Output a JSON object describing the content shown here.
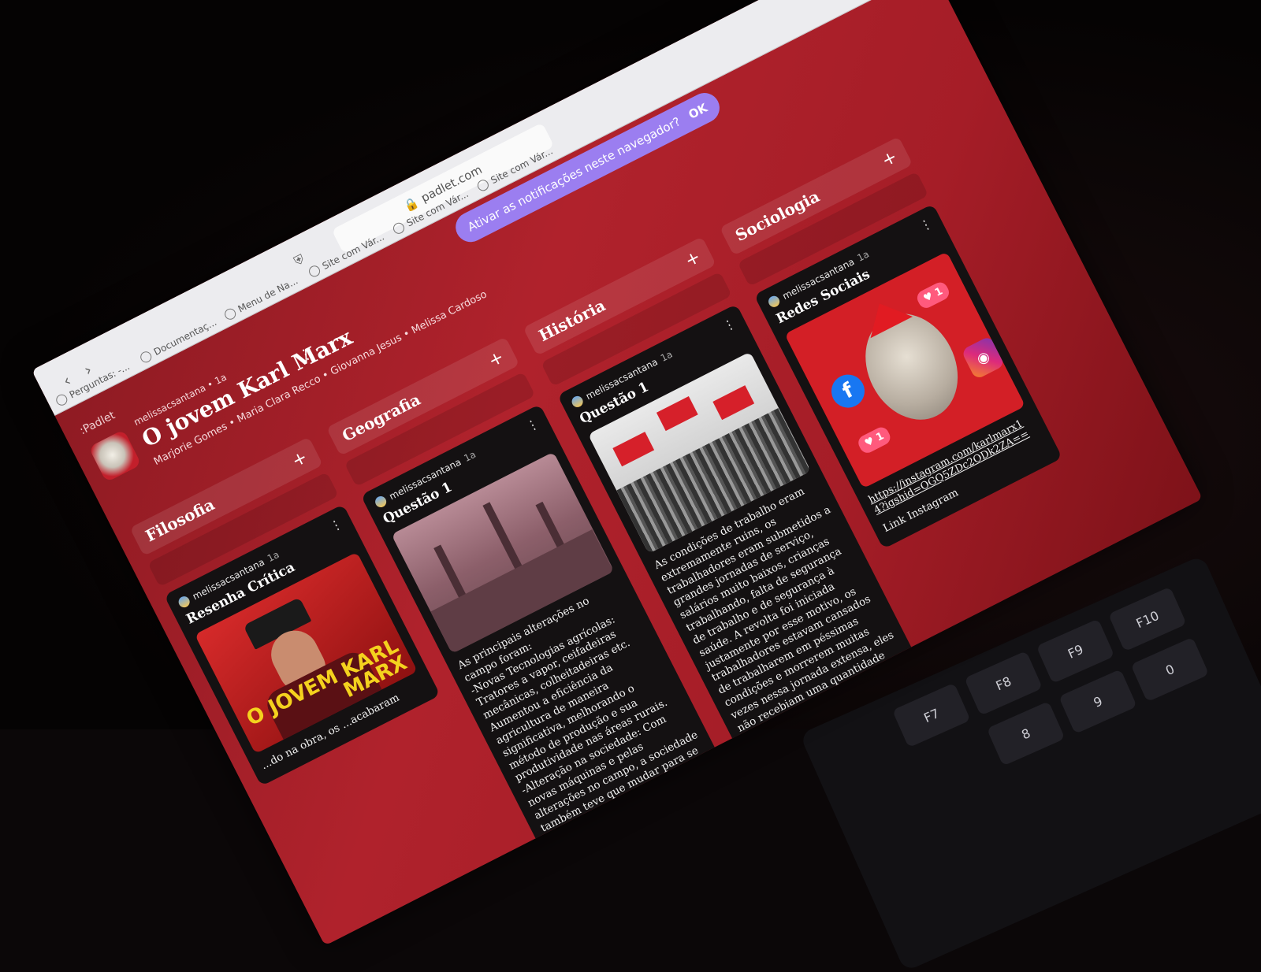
{
  "browser": {
    "url": "padlet.com",
    "tabs": [
      "Perguntas: -...",
      "Documentaç...",
      "Menu de Na...",
      "Site com Vár...",
      "Site com Vár...",
      "Site com Vár..."
    ]
  },
  "notification": {
    "text": "Ativar as notificações neste navegador?",
    "ok": "OK"
  },
  "board": {
    "app_name": ":Padlet",
    "author": "melissacsantana",
    "age": "1a",
    "title": "O jovem Karl Marx",
    "subtitle": "Marjorie Gomes • Maria Clara Recco • Giovanna Jesus • Melissa Cardoso"
  },
  "columns": [
    {
      "title": "Filosofia",
      "card": {
        "author": "melissacsantana",
        "age": "1a",
        "title": "Resenha Crítica",
        "image": "movie-poster",
        "poster_text": "O JOVEM KARL MARX",
        "body": "...do na obra, os ...acabaram"
      }
    },
    {
      "title": "Geografia",
      "card": {
        "author": "melissacsantana",
        "age": "1a",
        "title": "Questão 1",
        "image": "factory-engraving",
        "body": "As principais alterações no campo foram:\n-Novas Tecnologias agrícolas: Tratores a vapor, ceifadeiras mecânicas, colheitadeiras etc. Aumentou a eficiência da agricultura de maneira significativa, melhorando o método de produção e sua produtividade nas áreas rurais.\n-Alteração na sociedade: Com novas máquinas e pelas alterações no campo, a sociedade também teve que mudar para se adaptar ao novo sistema."
      }
    },
    {
      "title": "História",
      "card": {
        "author": "melissacsantana",
        "age": "1a",
        "title": "Questão 1",
        "image": "protest-crowd",
        "body": "As condições de trabalho eram extremamente ruins, os trabalhadores eram submetidos a grandes jornadas de serviço, salários muito baixos, crianças trabalhando, falta de segurança de trabalho e de segurança à saúde. A revolta foi iniciada justamente por esse motivo, os trabalhadores estavam cansados de trabalharem em péssimas condições e morrerem muitas vezes nessa jornada extensa, eles não recebiam uma quantidade equivalente ao tanto que trabalhavam e não tinham nenhum direito trabalhista."
      }
    },
    {
      "title": "Sociologia",
      "card": {
        "author": "melissacsantana",
        "age": "1a",
        "title": "Redes Sociais",
        "image": "marx-social-collage",
        "link": "https://instagram.com/karlmarx14?igshid=OGQ5ZDc2ODk2ZA==",
        "link_label": "Link Instagram",
        "likes": "1"
      }
    }
  ],
  "keyboard": {
    "keys": [
      "F10",
      "F9",
      "F8",
      "F7",
      "0",
      "9",
      "8"
    ]
  },
  "colors": {
    "board_bg": "#a51d27",
    "card_bg": "#141112",
    "notification": "#9b7ef0",
    "accent_yellow": "#f4d21e"
  }
}
